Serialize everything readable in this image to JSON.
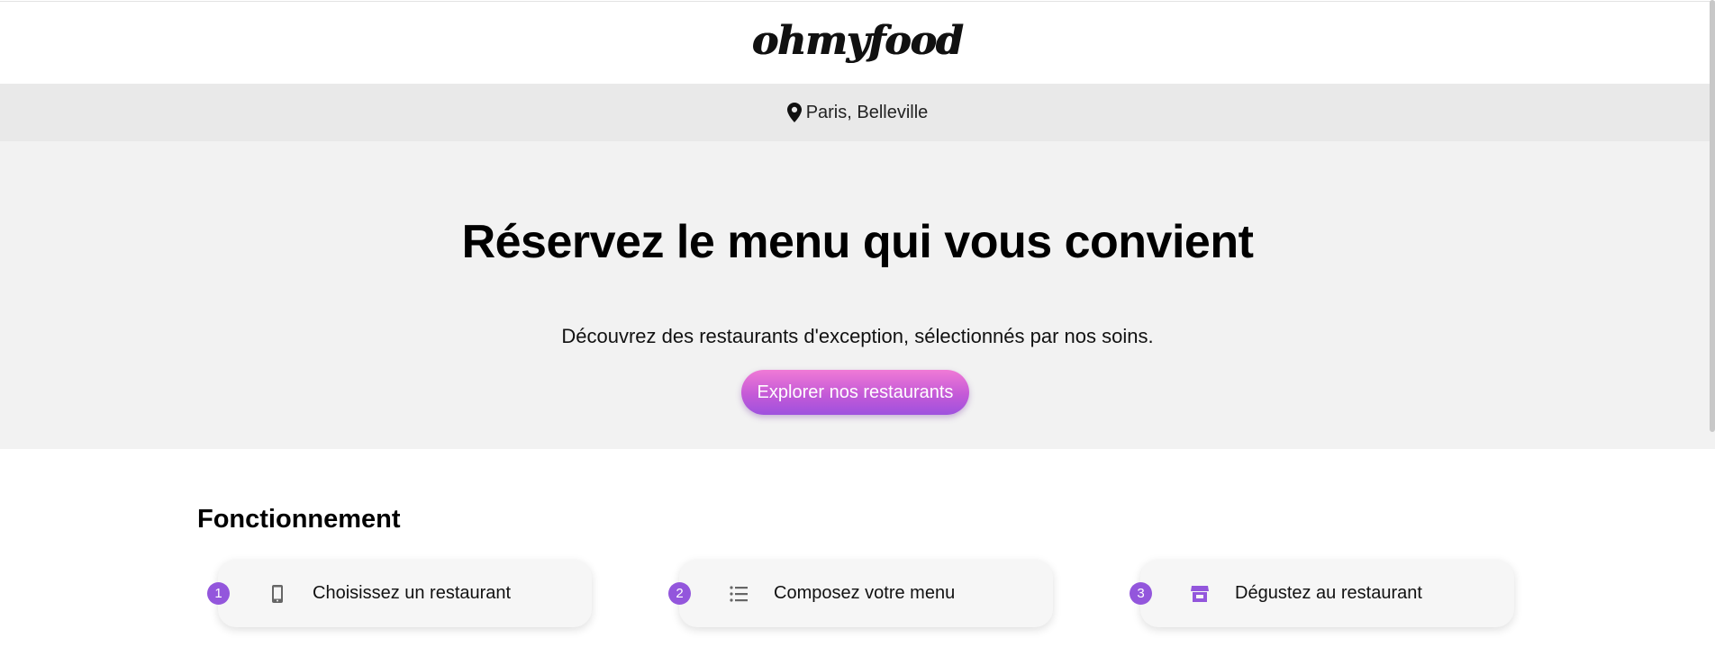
{
  "header": {
    "logo": "ohmyfood"
  },
  "location": {
    "icon": "map-pin-icon",
    "text": "Paris, Belleville"
  },
  "hero": {
    "title": "Réservez le menu qui vous convient",
    "subtitle": "Découvrez des restaurants d'exception, sélectionnés par nos soins.",
    "cta_label": "Explorer nos restaurants"
  },
  "how_it_works": {
    "title": "Fonctionnement",
    "steps": [
      {
        "number": "1",
        "icon": "phone-icon",
        "label": "Choisissez un restaurant"
      },
      {
        "number": "2",
        "icon": "list-icon",
        "label": "Composez votre menu"
      },
      {
        "number": "3",
        "icon": "store-icon",
        "label": "Dégustez au restaurant"
      }
    ]
  },
  "colors": {
    "accent": "#9356dc",
    "cta_gradient_top": "#f07ad6",
    "cta_gradient_bottom": "#9e51de",
    "location_bar_bg": "#e9e9e9",
    "hero_bg": "#f2f2f2"
  }
}
